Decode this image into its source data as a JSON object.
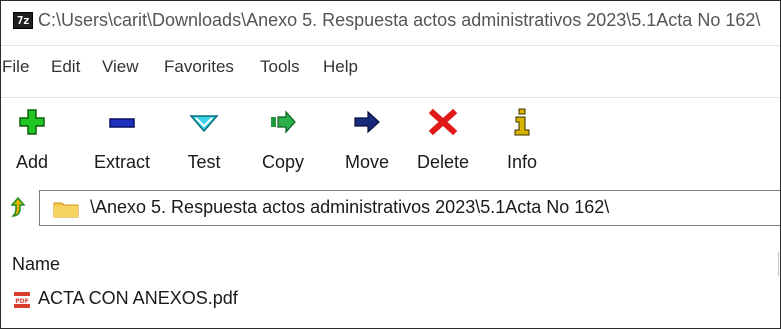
{
  "window": {
    "app_icon_text": "7z",
    "title": "C:\\Users\\carit\\Downloads\\Anexo 5. Respuesta actos administrativos 2023\\5.1Acta No 162\\"
  },
  "menu": {
    "items": [
      {
        "label": "File"
      },
      {
        "label": "Edit"
      },
      {
        "label": "View"
      },
      {
        "label": "Favorites"
      },
      {
        "label": "Tools"
      },
      {
        "label": "Help"
      }
    ]
  },
  "toolbar": {
    "buttons": [
      {
        "label": "Add",
        "icon": "plus-icon",
        "color": "#22c422"
      },
      {
        "label": "Extract",
        "icon": "minus-icon",
        "color": "#1f2fbf"
      },
      {
        "label": "Test",
        "icon": "chevron-down-icon",
        "color": "#38d3e8"
      },
      {
        "label": "Copy",
        "icon": "copy-arrow-icon",
        "color": "#1f9a3a"
      },
      {
        "label": "Move",
        "icon": "arrow-right-icon",
        "color": "#1a2a7a"
      },
      {
        "label": "Delete",
        "icon": "x-icon",
        "color": "#e01818"
      },
      {
        "label": "Info",
        "icon": "info-icon",
        "color": "#d8b400"
      }
    ]
  },
  "address": {
    "path": "\\Anexo 5. Respuesta actos administrativos 2023\\5.1Acta No 162\\"
  },
  "filelist": {
    "columns": [
      {
        "label": "Name"
      }
    ],
    "rows": [
      {
        "name": "ACTA CON ANEXOS.pdf",
        "icon": "pdf-icon",
        "icon_text": "PDF"
      }
    ]
  }
}
